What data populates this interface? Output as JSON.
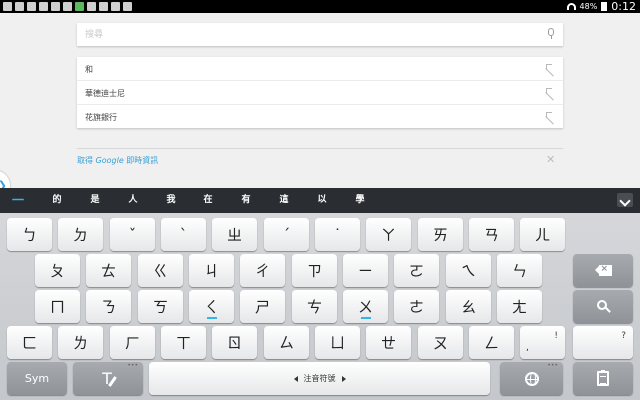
{
  "status_bar": {
    "battery": "48%",
    "time": "0:12",
    "left_icons": [
      "usb-icon",
      "sim-icon",
      "cloud-icon",
      "image-icon",
      "facebook-icon",
      "app-icon",
      "android-icon",
      "arrow-icon",
      "book-icon",
      "check-icon",
      "calendar-icon"
    ]
  },
  "search": {
    "placeholder": "搜尋",
    "value": ""
  },
  "suggestions": [
    {
      "text": "和"
    },
    {
      "text": "華德迪士尼"
    },
    {
      "text": "花旗銀行"
    }
  ],
  "now_card": {
    "text_before": "取得 ",
    "brand": "Google",
    "text_after": " 即時資訊"
  },
  "candidates": {
    "first": "一",
    "items": [
      "的",
      "是",
      "人",
      "我",
      "在",
      "有",
      "這",
      "以",
      "學"
    ]
  },
  "keyboard": {
    "row1": [
      "ㄅ",
      "ㄉ",
      "ˇ",
      "ˋ",
      "ㄓ",
      "ˊ",
      "˙",
      "ㄚ",
      "ㄞ",
      "ㄢ",
      "ㄦ"
    ],
    "row2": [
      "ㄆ",
      "ㄊ",
      "ㄍ",
      "ㄐ",
      "ㄔ",
      "ㄗ",
      "ㄧ",
      "ㄛ",
      "ㄟ",
      "ㄣ"
    ],
    "row3": [
      "ㄇ",
      "ㄋ",
      "ㄎ",
      "ㄑ",
      "ㄕ",
      "ㄘ",
      "ㄨ",
      "ㄜ",
      "ㄠ",
      "ㄤ"
    ],
    "row4": [
      "ㄈ",
      "ㄌ",
      "ㄏ",
      "ㄒ",
      "ㄖ",
      "ㄙ",
      "ㄩ",
      "ㄝ",
      "ㄡ",
      "ㄥ"
    ],
    "row4_punct_main": ",",
    "row4_punct_alt": "!",
    "question": "?",
    "sym": "Sym",
    "t_label": "T",
    "space_label": "注音符號",
    "dots": "•••"
  },
  "colors": {
    "accent": "#34b5e5",
    "candidate_bar": "#2a2d31",
    "status_bar": "#000000"
  }
}
